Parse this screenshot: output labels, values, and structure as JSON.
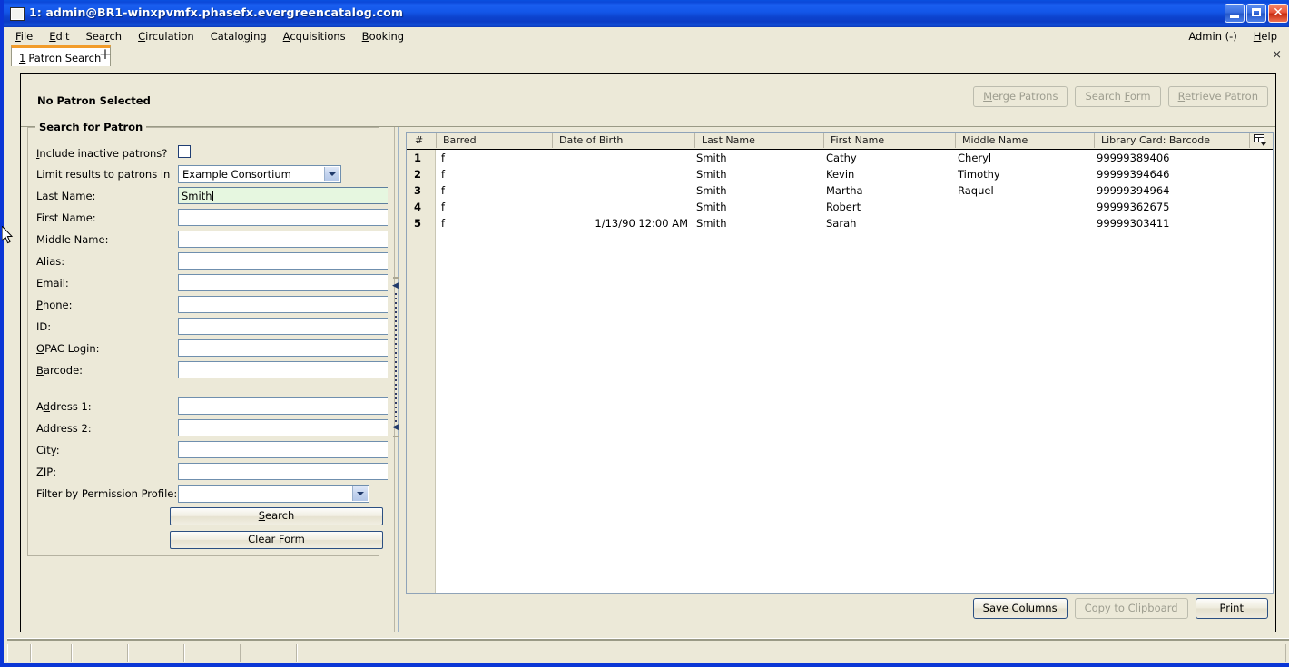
{
  "window": {
    "title": "1: admin@BR1-winxpvmfx.phasefx.evergreencatalog.com",
    "icon": "window-icon",
    "minimize_label": "",
    "maximize_label": "",
    "close_label": "✕"
  },
  "menubar": {
    "items": [
      {
        "label": "File",
        "accel": "F"
      },
      {
        "label": "Edit",
        "accel": "E"
      },
      {
        "label": "Search",
        "accel": "r"
      },
      {
        "label": "Circulation",
        "accel": "C"
      },
      {
        "label": "Cataloging",
        "accel": "g"
      },
      {
        "label": "Acquisitions",
        "accel": "A"
      },
      {
        "label": "Booking",
        "accel": "B"
      }
    ],
    "right": [
      {
        "label": "Admin (-)",
        "accel": ""
      },
      {
        "label": "Help",
        "accel": "H"
      }
    ]
  },
  "tabs": {
    "active": {
      "number": "1",
      "label": "Patron Search"
    },
    "add_label": "+",
    "close_label": "×"
  },
  "patron_header": {
    "status": "No Patron Selected",
    "buttons": [
      {
        "label": "Merge Patrons",
        "accel": "M",
        "disabled": true
      },
      {
        "label": "Search Form",
        "accel": "F",
        "disabled": true
      },
      {
        "label": "Retrieve Patron",
        "accel": "R",
        "disabled": true
      }
    ]
  },
  "search_form": {
    "legend": "Search for Patron",
    "fields": [
      {
        "label": "Include inactive patrons?",
        "accel": "I",
        "type": "checkbox",
        "checked": false,
        "value": ""
      },
      {
        "label": "Limit results to patrons in",
        "accel": "",
        "type": "select",
        "value": "Example Consortium"
      },
      {
        "label": "Last Name:",
        "accel": "L",
        "type": "text",
        "value": "Smith",
        "focused": true
      },
      {
        "label": "First Name:",
        "accel": "",
        "type": "text",
        "value": ""
      },
      {
        "label": "Middle Name:",
        "accel": "",
        "type": "text",
        "value": ""
      },
      {
        "label": "Alias:",
        "accel": "",
        "type": "text",
        "value": ""
      },
      {
        "label": "Email:",
        "accel": "",
        "type": "text",
        "value": ""
      },
      {
        "label": "Phone:",
        "accel": "P",
        "type": "text",
        "value": ""
      },
      {
        "label": "ID:",
        "accel": "I",
        "type": "text",
        "value": ""
      },
      {
        "label": "OPAC Login:",
        "accel": "O",
        "type": "text",
        "value": ""
      },
      {
        "label": "Barcode:",
        "accel": "B",
        "type": "text",
        "value": ""
      },
      {
        "label": "Address 1:",
        "accel": "d",
        "type": "text",
        "value": ""
      },
      {
        "label": "Address 2:",
        "accel": "",
        "type": "text",
        "value": ""
      },
      {
        "label": "City:",
        "accel": "",
        "type": "text",
        "value": ""
      },
      {
        "label": "ZIP:",
        "accel": "",
        "type": "text",
        "value": ""
      },
      {
        "label": "Filter by Permission Profile:",
        "accel": "",
        "type": "select",
        "value": ""
      }
    ],
    "buttons": [
      {
        "label": "Search",
        "accel": "S"
      },
      {
        "label": "Clear Form",
        "accel": "C"
      }
    ]
  },
  "results": {
    "columns": [
      "#",
      "Barred",
      "Date of Birth",
      "Last Name",
      "First Name",
      "Middle Name",
      "Library Card: Barcode"
    ],
    "column_picker_icon": "column-picker-icon",
    "rows": [
      {
        "num": "1",
        "barred": "f",
        "dob": "",
        "last": "Smith",
        "first": "Cathy",
        "middle": "Cheryl",
        "barcode": "99999389406"
      },
      {
        "num": "2",
        "barred": "f",
        "dob": "",
        "last": "Smith",
        "first": "Kevin",
        "middle": "Timothy",
        "barcode": "99999394646"
      },
      {
        "num": "3",
        "barred": "f",
        "dob": "",
        "last": "Smith",
        "first": "Martha",
        "middle": "Raquel",
        "barcode": "99999394964"
      },
      {
        "num": "4",
        "barred": "f",
        "dob": "",
        "last": "Smith",
        "first": "Robert",
        "middle": "",
        "barcode": "99999362675"
      },
      {
        "num": "5",
        "barred": "f",
        "dob": "1/13/90 12:00 AM",
        "last": "Smith",
        "first": "Sarah",
        "middle": "",
        "barcode": "99999303411"
      }
    ],
    "buttons": [
      {
        "label": "Save Columns",
        "disabled": false
      },
      {
        "label": "Copy to Clipboard",
        "disabled": true
      },
      {
        "label": "Print",
        "disabled": false
      }
    ]
  },
  "colors": {
    "titlebar_blue": "#1356e8",
    "window_border": "#0a36d6",
    "face": "#ece9d8",
    "tab_accent": "#f29c2a",
    "focused_input_bg": "#e6f7e0",
    "field_border": "#6f8fae"
  },
  "statusbar": {
    "segments": [
      "",
      "",
      "",
      "",
      "",
      "",
      ""
    ]
  }
}
